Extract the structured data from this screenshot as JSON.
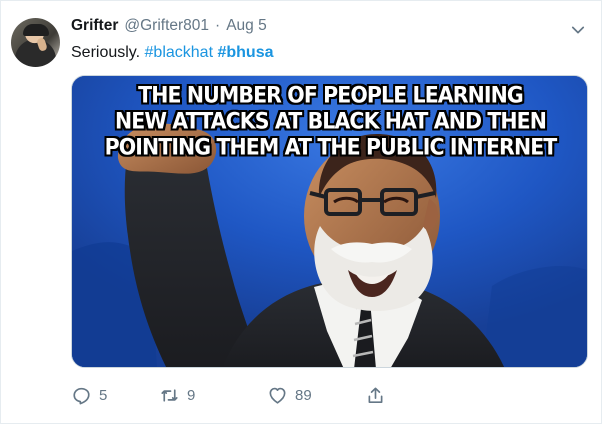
{
  "tweet": {
    "author_name": "Grifter",
    "handle": "@Grifter801",
    "separator": "·",
    "date": "Aug 5",
    "text_prefix": "Seriously.",
    "hashtags": [
      "#blackhat",
      "#bhusa"
    ],
    "media": {
      "meme_lines": [
        "THE NUMBER OF PEOPLE LEARNING",
        "NEW ATTACKS AT BLACK HAT AND THEN",
        "POINTING THEM AT THE PUBLIC INTERNET"
      ]
    },
    "actions": {
      "reply_count": "5",
      "retweet_count": "9",
      "like_count": "89"
    }
  },
  "icons": {
    "chevron": "chevron-down-icon",
    "reply": "reply-icon",
    "retweet": "retweet-icon",
    "like": "heart-icon",
    "share": "share-icon"
  },
  "colors": {
    "link": "#1b95e0",
    "secondary_text": "#657786",
    "meme_background": "#1d57c0"
  }
}
